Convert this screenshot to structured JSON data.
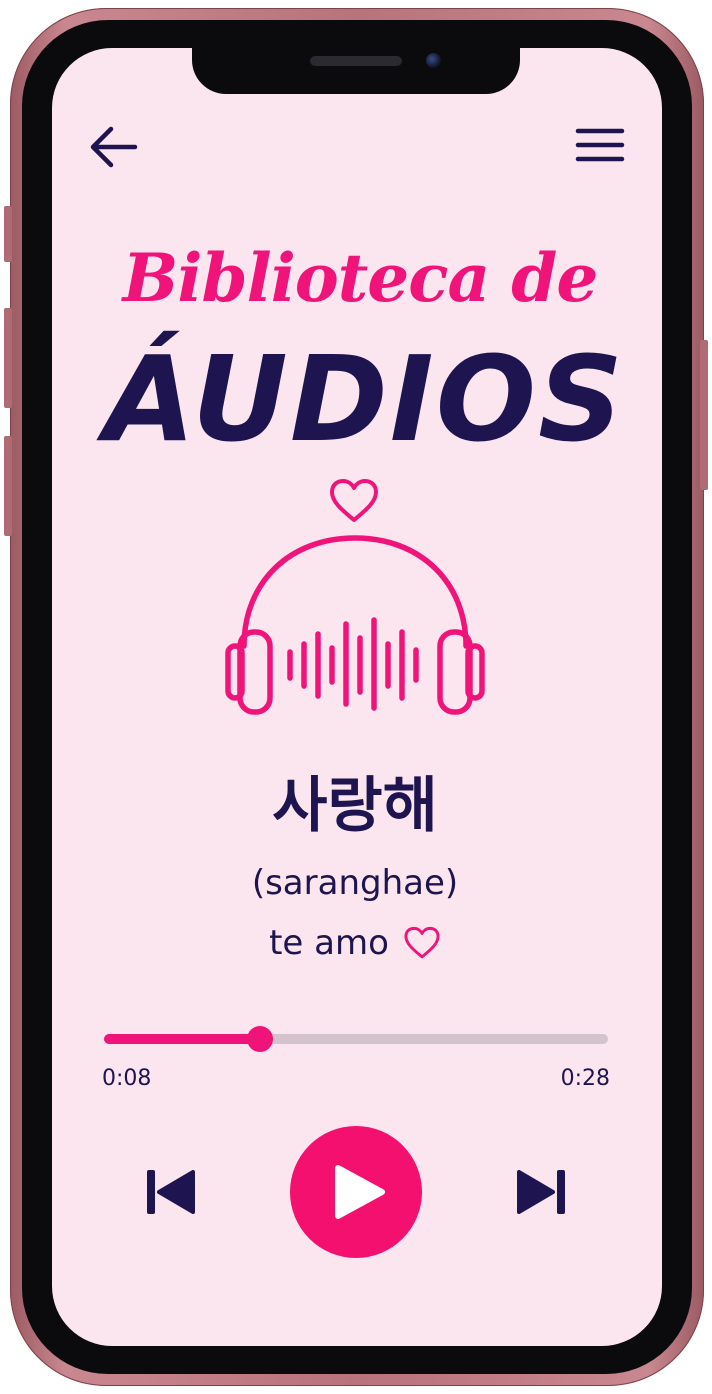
{
  "header": {
    "back_icon": "arrow-left-icon",
    "menu_icon": "hamburger-menu-icon"
  },
  "title": {
    "line1": "Biblioteca de",
    "line2": "ÁUDIOS"
  },
  "decoration": {
    "heart_icon": "heart-outline-icon",
    "headphones_icon": "headphones-soundwave-icon"
  },
  "word": {
    "korean": "사랑해",
    "romanization": "(saranghae)",
    "translation": "te amo"
  },
  "player": {
    "current_time": "0:08",
    "total_time": "0:28",
    "progress": 0.31,
    "prev_icon": "skip-previous-icon",
    "play_icon": "play-icon",
    "next_icon": "skip-next-icon"
  },
  "colors": {
    "accent": "#f0147a",
    "text_dark": "#1e1450",
    "screen_bg": "#fbe6ef",
    "track": "#d3c3cc"
  }
}
